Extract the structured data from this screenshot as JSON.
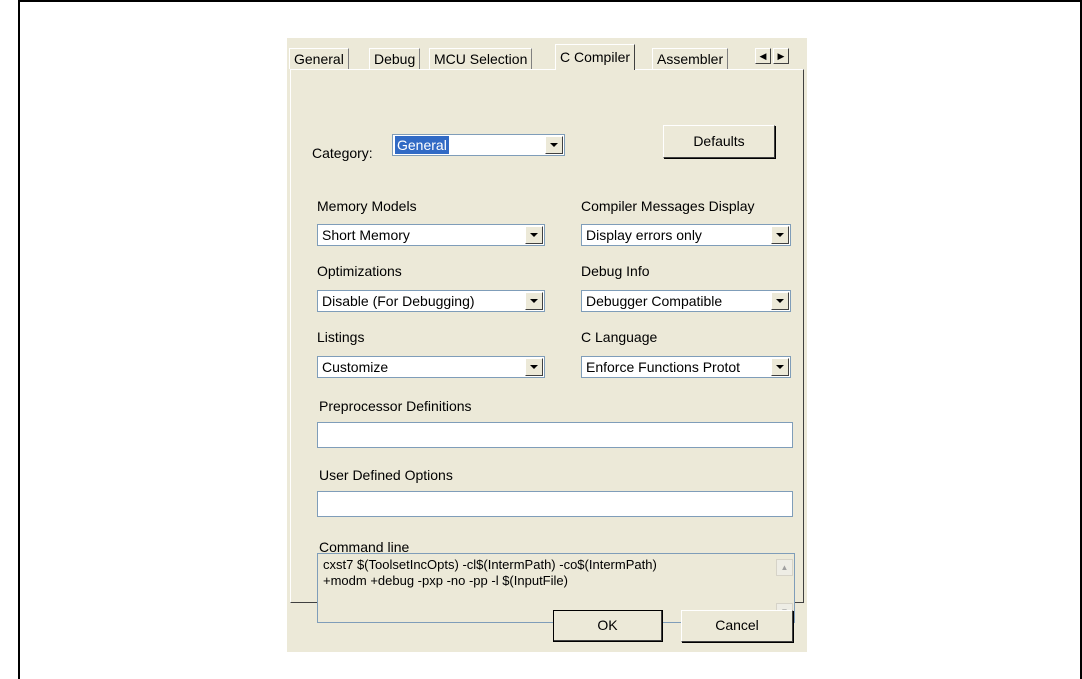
{
  "tabs": {
    "items": [
      "General",
      "Debug",
      "MCU Selection",
      "C Compiler",
      "Assembler"
    ],
    "active": "C Compiler",
    "scroll_left": "◀",
    "scroll_right": "▶"
  },
  "category": {
    "label": "Category:",
    "value": "General"
  },
  "defaults_button": "Defaults",
  "fields": {
    "memory_models": {
      "label": "Memory Models",
      "value": "Short Memory"
    },
    "compiler_messages": {
      "label": "Compiler Messages Display",
      "value": "Display errors only"
    },
    "optimizations": {
      "label": "Optimizations",
      "value": "Disable (For Debugging)"
    },
    "debug_info": {
      "label": "Debug Info",
      "value": "Debugger Compatible"
    },
    "listings": {
      "label": "Listings",
      "value": "Customize"
    },
    "c_language": {
      "label": "C Language",
      "value": "Enforce Functions Protot"
    },
    "preprocessor": {
      "label": "Preprocessor Definitions",
      "value": ""
    },
    "user_options": {
      "label": "User Defined Options",
      "value": ""
    }
  },
  "command_line": {
    "label": "Command line",
    "line1": "cxst7 $(ToolsetIncOpts) -cl$(IntermPath) -co$(IntermPath)",
    "line2": "+modm +debug -pxp -no -pp -l $(InputFile)"
  },
  "buttons": {
    "ok": "OK",
    "cancel": "Cancel"
  },
  "colors": {
    "dialog_bg": "#ece9d8",
    "selection": "#316ac5"
  }
}
